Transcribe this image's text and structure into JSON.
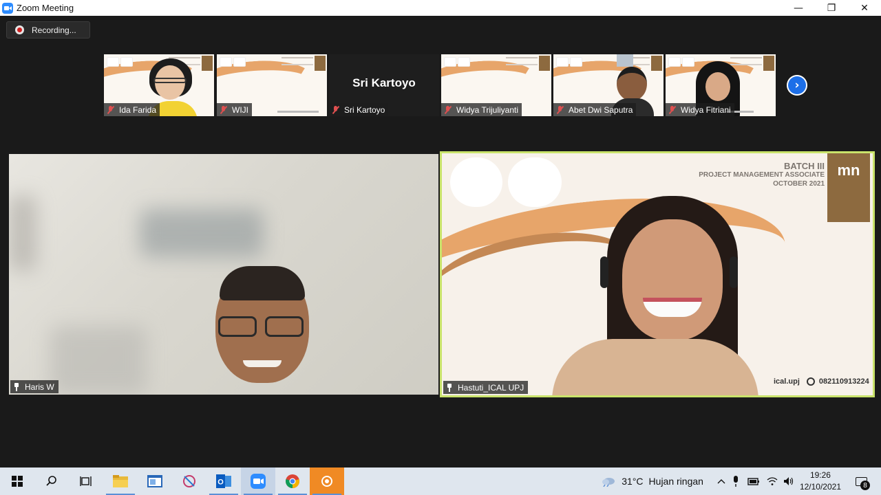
{
  "window": {
    "title": "Zoom Meeting",
    "minimize_glyph": "—",
    "maximize_glyph": "❐",
    "close_glyph": "✕"
  },
  "recording": {
    "label": "Recording..."
  },
  "thumbnails": [
    {
      "name": "Ida Farida",
      "muted": true,
      "video": true
    },
    {
      "name": "WIJI",
      "muted": true,
      "video": true
    },
    {
      "name": "Sri Kartoyo",
      "display_name": "Sri Kartoyo",
      "muted": true,
      "video": false
    },
    {
      "name": "Widya Trijuliyanti",
      "muted": true,
      "video": true
    },
    {
      "name": "Abet Dwi Saputra",
      "muted": true,
      "video": true
    },
    {
      "name": "Widya Fitriani",
      "muted": true,
      "video": true
    }
  ],
  "next_page_glyph": "›",
  "main_tiles": [
    {
      "name": "Haris W",
      "pinned": true
    },
    {
      "name": "Hastuti_ICAL UPJ",
      "pinned": true,
      "active_speaker": true,
      "banner": {
        "batch": "BATCH III",
        "program": "PROJECT MANAGEMENT ASSOCIATE",
        "date": "OCTOBER 2021",
        "badge": "mn",
        "contact_handle": "ical.upj",
        "contact_phone": "082110913224"
      }
    }
  ],
  "taskbar": {
    "weather": {
      "temp": "31°C",
      "desc": "Hujan ringan"
    },
    "time": "19:26",
    "date": "12/10/2021",
    "notifications": "8"
  },
  "colors": {
    "zoom_blue": "#2d8cff",
    "active_speaker_border": "#c9e36b",
    "muted_red": "#e05050",
    "banner_orange": "#e7a56a",
    "taskbar_bg": "#dfe6ee"
  }
}
